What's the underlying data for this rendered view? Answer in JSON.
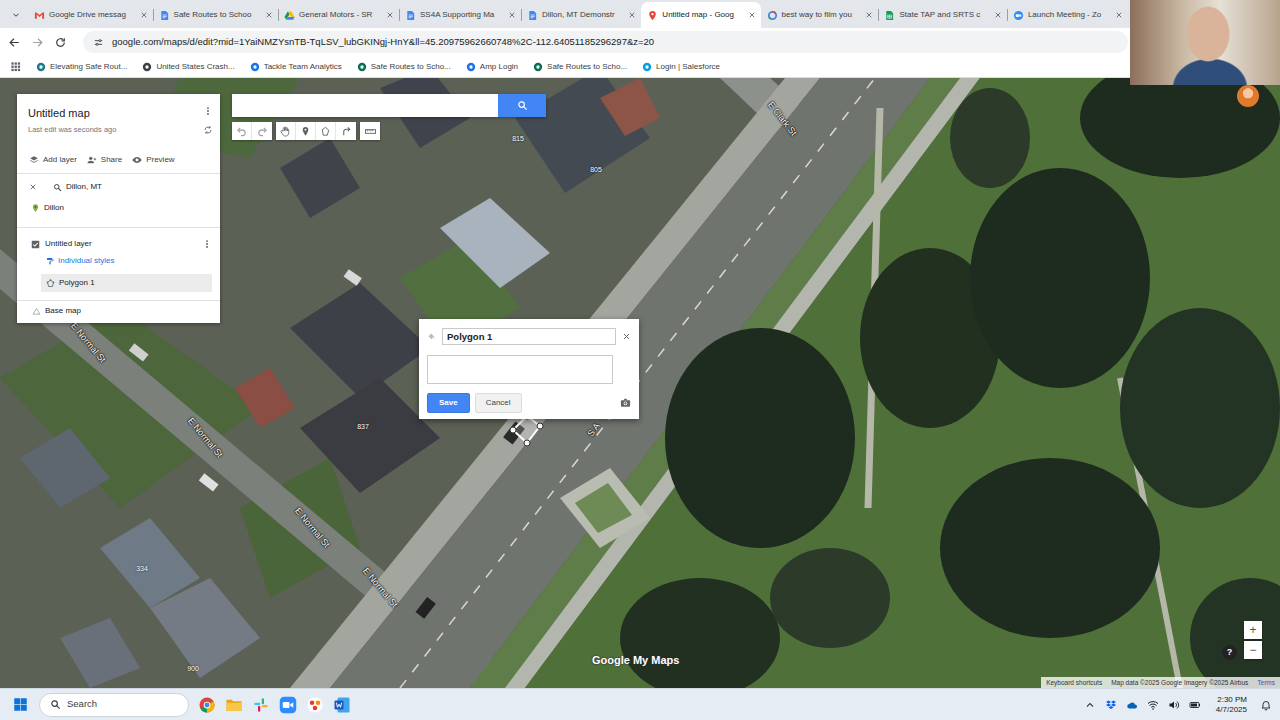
{
  "browser": {
    "tabs": [
      {
        "label": "Google Drive messag",
        "selected": false
      },
      {
        "label": "Safe Routes to Schoo",
        "selected": false
      },
      {
        "label": "General Motors - SR",
        "selected": false
      },
      {
        "label": "SS4A Supporting Ma",
        "selected": false
      },
      {
        "label": "Dillon, MT Demonstr",
        "selected": false
      },
      {
        "label": "Untitled map - Goog",
        "selected": true
      },
      {
        "label": "best way to film you",
        "selected": false
      },
      {
        "label": "State TAP and SRTS c",
        "selected": false
      },
      {
        "label": "Launch Meeting - Zo",
        "selected": false
      }
    ],
    "url": "google.com/maps/d/edit?mid=1YaiNMZYsnTB-TqLSV_lubGKINgj-HnY&ll=45.20975962660748%2C-112.64051185296297&z=20",
    "bookmarks": [
      "Elevating Safe Rout...",
      "United States Crash...",
      "Tackle Team Analytics",
      "Safe Routes to Scho...",
      "Amp Login",
      "Safe Routes to Scho...",
      "Login | Salesforce"
    ]
  },
  "map_editor": {
    "title": "Untitled map",
    "last_edit": "Last edit was seconds ago",
    "actions": [
      "Add layer",
      "Share",
      "Preview"
    ],
    "search_result": {
      "query": "Dillon, MT",
      "places": [
        "Dillon"
      ]
    },
    "layers": [
      {
        "name": "Untitled layer",
        "checked": true,
        "style": "Individual styles",
        "features": [
          {
            "label": "Polygon 1",
            "selected": true
          }
        ]
      }
    ],
    "base_map": "Base map",
    "street_labels": [
      "E Clark St",
      "E Normal St",
      "E Normal St",
      "E Normal St",
      "E Normal St",
      "S A"
    ],
    "house_numbers": [
      "815",
      "805",
      "837",
      "334",
      "900"
    ],
    "dialog": {
      "title": "Polygon 1",
      "description": "",
      "save": "Save",
      "cancel": "Cancel"
    },
    "zoom": [
      "+",
      "−"
    ],
    "help": "?",
    "brand": "Google My Maps",
    "attribution": [
      "Keyboard shortcuts",
      "Map data ©2025 Google Imagery ©2025 Airbus",
      "Terms"
    ]
  },
  "taskbar": {
    "search": "Search",
    "time": "2:30 PM",
    "date": "4/7/2025"
  }
}
